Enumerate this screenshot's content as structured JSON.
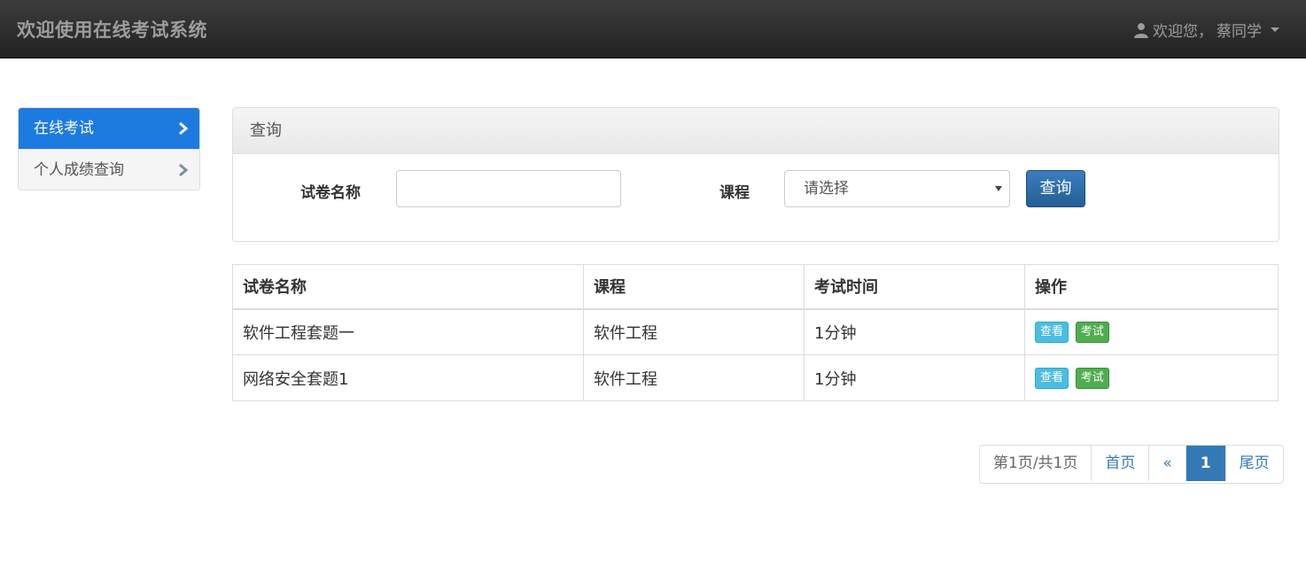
{
  "navbar": {
    "brand": "欢迎使用在线考试系统",
    "user_greeting": "欢迎您，",
    "user_name": "蔡同学"
  },
  "sidebar": {
    "items": [
      {
        "label": "在线考试",
        "active": true
      },
      {
        "label": "个人成绩查询",
        "active": false
      }
    ]
  },
  "query_panel": {
    "title": "查询",
    "paper_name_label": "试卷名称",
    "paper_name_value": "",
    "course_label": "课程",
    "course_selected": "请选择",
    "submit_label": "查询"
  },
  "table": {
    "headers": [
      "试卷名称",
      "课程",
      "考试时间",
      "操作"
    ],
    "rows": [
      {
        "paper": "软件工程套题一",
        "course": "软件工程",
        "duration": "1分钟"
      },
      {
        "paper": "网络安全套题1",
        "course": "软件工程",
        "duration": "1分钟"
      }
    ],
    "view_label": "查看",
    "exam_label": "考试"
  },
  "pagination": {
    "info": "第1页/共1页",
    "first": "首页",
    "prev": "«",
    "current": "1",
    "last": "尾页"
  },
  "colors": {
    "navbar_bg": "#222222",
    "sidebar_active": "#1d7be0",
    "primary": "#337ab7",
    "info_button": "#4bbde0",
    "success_button": "#4fae4f"
  },
  "icons": {
    "user": "user-icon",
    "caret": "caret-down-icon",
    "chevron": "chevron-right-icon",
    "select_arrow": "select-arrow-icon"
  }
}
